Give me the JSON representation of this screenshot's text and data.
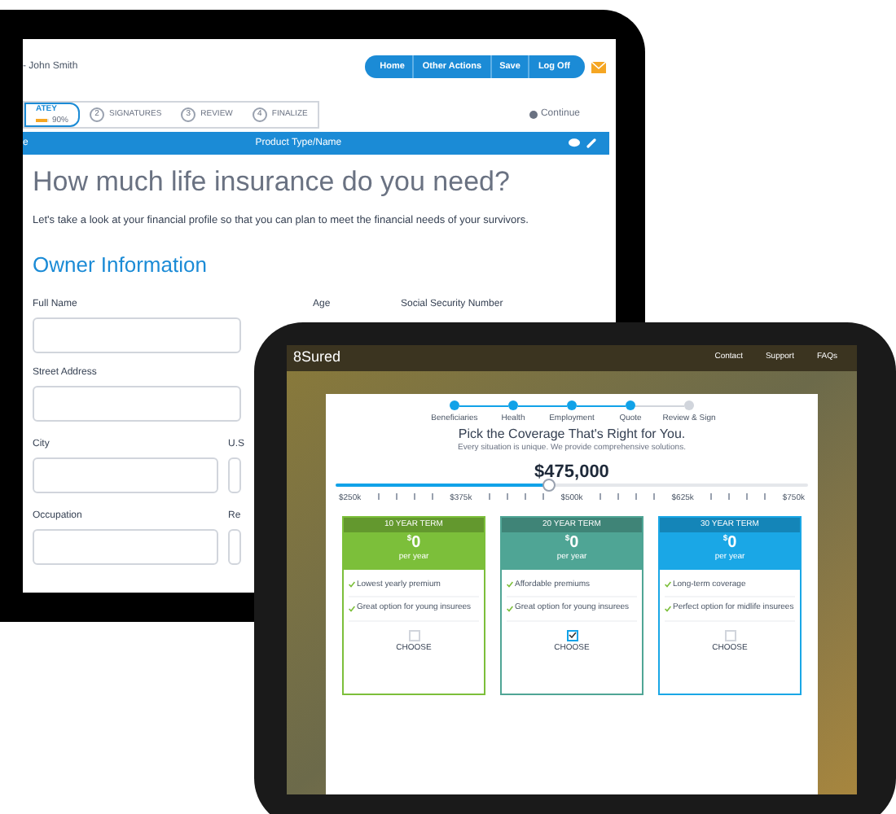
{
  "laptop": {
    "user_label": "- John Smith",
    "nav_buttons": [
      "Home",
      "Other Actions",
      "Save",
      "Log Off"
    ],
    "steps": [
      {
        "label": "ATEY",
        "progress": "90%",
        "level": 0.9,
        "selected": true
      },
      {
        "number": "2",
        "label": "SIGNATURES",
        "selected": false
      },
      {
        "number": "3",
        "label": "REVIEW",
        "selected": false
      },
      {
        "number": "4",
        "label": "FINALIZE",
        "selected": false
      }
    ],
    "continue": "Continue",
    "bar": {
      "left": "e",
      "title": "Product Type/Name"
    },
    "heading": "How much life insurance do you need?",
    "intro": "Let's take a look at your financial profile so that you can plan to meet the financial needs of your survivors.",
    "section": "Owner Information",
    "fields": [
      {
        "label": "Full Name"
      },
      {
        "label": "Age"
      },
      {
        "label": "Social Security Number"
      },
      {
        "label": "Street Address"
      },
      {
        "label": "City"
      },
      {
        "label": "U.S"
      },
      {
        "label": "Occupation"
      },
      {
        "label": "Re"
      }
    ]
  },
  "tablet": {
    "logo": "8Sured",
    "nav": [
      "Contact",
      "Support",
      "FAQs"
    ],
    "progress_steps": [
      {
        "label": "Beneficiaries",
        "done": true
      },
      {
        "label": "Health",
        "done": true
      },
      {
        "label": "Employment",
        "done": true
      },
      {
        "label": "Quote",
        "done": true
      },
      {
        "label": "Review & Sign",
        "done": false
      }
    ],
    "title": "Pick the Coverage That's Right for You.",
    "subtitle": "Every situation is unique. We provide comprehensive solutions.",
    "amount": "$475,000",
    "slider": {
      "level": 0.45
    },
    "ticks": [
      "$250k",
      "$375k",
      "$500k",
      "$625k",
      "$750k"
    ],
    "plans": [
      {
        "term": "10 YEAR TERM",
        "price": "0",
        "currency": "$",
        "period": "per year",
        "color": "#7cbf3a",
        "features": [
          "Lowest yearly premium",
          "Great option for young insurees"
        ],
        "choose": "CHOOSE",
        "checked": false
      },
      {
        "term": "20 YEAR TERM",
        "price": "0",
        "currency": "$",
        "period": "per year",
        "color": "#4fa595",
        "features": [
          "Affordable premiums",
          "Great option for young insurees"
        ],
        "choose": "CHOOSE",
        "checked": true
      },
      {
        "term": "30 YEAR TERM",
        "price": "0",
        "currency": "$",
        "period": "per year",
        "color": "#1aa7e6",
        "features": [
          "Long-term coverage",
          "Perfect option for midlife insurees"
        ],
        "choose": "CHOOSE",
        "checked": false
      }
    ]
  }
}
